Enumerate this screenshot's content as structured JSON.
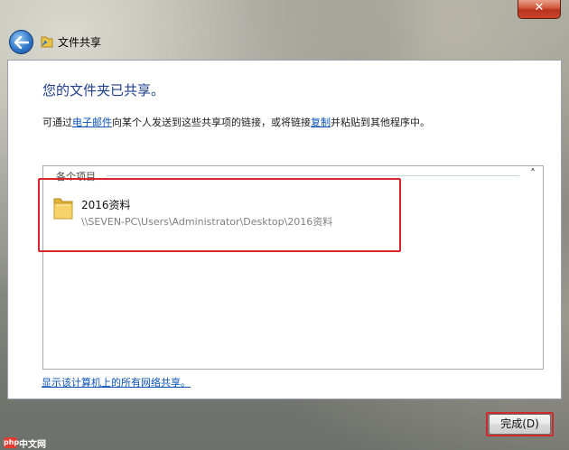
{
  "window": {
    "title": "文件共享",
    "close_label": "✕"
  },
  "main": {
    "heading": "您的文件夹已共享。",
    "instruction_before": "可通过",
    "instruction_email_link": "电子邮件",
    "instruction_middle": "向某个人发送到这些共享项的链接，或将链接",
    "instruction_copy_link": "复制",
    "instruction_after": "并粘贴到其他程序中。"
  },
  "items_group": {
    "header": "各个项目",
    "collapse_glyph": "˄",
    "items": [
      {
        "name": "2016资料",
        "path": "\\\\SEVEN-PC\\Users\\Administrator\\Desktop\\2016资料"
      }
    ]
  },
  "footer": {
    "network_link": "显示该计算机上的所有网络共享。",
    "done_button": "完成(D)"
  },
  "watermark": {
    "badge": "php",
    "text": "中文网"
  },
  "colors": {
    "heading": "#1f3e8c",
    "link": "#0b52b8",
    "highlight": "#d7262e"
  },
  "icons": [
    "back-arrow-icon",
    "file-sharing-icon",
    "folder-icon",
    "close-icon"
  ]
}
